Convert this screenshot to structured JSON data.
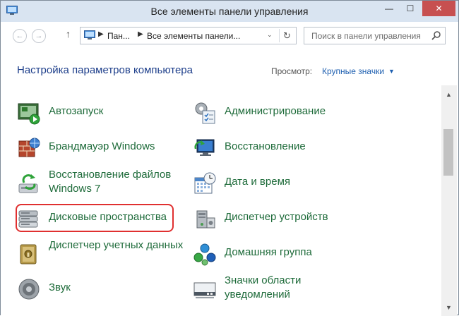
{
  "window": {
    "title": "Все элементы панели управления",
    "min_glyph": "—",
    "max_glyph": "☐",
    "close_glyph": "✕"
  },
  "nav": {
    "back_glyph": "←",
    "forward_glyph": "→",
    "up_glyph": "↑",
    "crumb_sep": "▶",
    "breadcrumbs": [
      "Пан...",
      "Все элементы панели..."
    ],
    "dropdown_glyph": "⌄",
    "refresh_glyph": "↻",
    "search_placeholder": "Поиск в панели управления"
  },
  "header": {
    "title": "Настройка параметров компьютера",
    "view_label": "Просмотр:",
    "view_value": "Крупные значки",
    "view_arrow": "▼"
  },
  "items_left": [
    {
      "label": "Автозапуск",
      "icon": "autoplay-icon"
    },
    {
      "label": "Брандмауэр Windows",
      "icon": "firewall-icon"
    },
    {
      "label": "Восстановление файлов Windows 7",
      "icon": "file-recovery-icon"
    },
    {
      "label": "Дисковые пространства",
      "icon": "storage-spaces-icon"
    },
    {
      "label": "Диспетчер учетных данных",
      "icon": "credential-manager-icon"
    },
    {
      "label": "Звук",
      "icon": "sound-icon"
    }
  ],
  "items_right": [
    {
      "label": "Администрирование",
      "icon": "admin-tools-icon"
    },
    {
      "label": "Восстановление",
      "icon": "recovery-icon"
    },
    {
      "label": "Дата и время",
      "icon": "date-time-icon"
    },
    {
      "label": "Диспетчер устройств",
      "icon": "device-manager-icon"
    },
    {
      "label": "Домашняя группа",
      "icon": "homegroup-icon"
    },
    {
      "label": "Значки области уведомлений",
      "icon": "notification-icons-icon"
    }
  ],
  "scrollbar": {
    "up_glyph": "▲",
    "down_glyph": "▼"
  },
  "colors": {
    "titlebar": "#d9e4f1",
    "close_button": "#c75050",
    "link_green": "#1e6b3a",
    "heading_blue": "#1e3f8b",
    "highlight_red": "#e03030"
  }
}
